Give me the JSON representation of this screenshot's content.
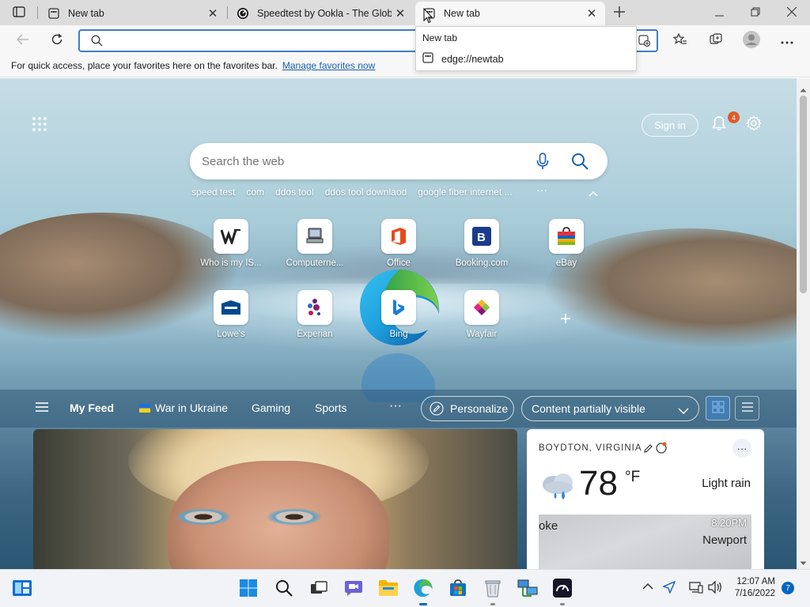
{
  "browser": {
    "tabs": [
      {
        "title": "New tab",
        "active": false
      },
      {
        "title": "Speedtest by Ookla - The Global Broadband Speed Test",
        "active": false
      },
      {
        "title": "New tab",
        "active": true
      }
    ],
    "address": {
      "value": "",
      "placeholder": ""
    },
    "favorites_bar": {
      "text": "For quick access, place your favorites here on the favorites bar.",
      "link": "Manage favorites now"
    },
    "tooltip": {
      "title": "New tab",
      "url": "edge://newtab"
    }
  },
  "newtab": {
    "signin_label": "Sign in",
    "notification_count": "4",
    "search_placeholder": "Search the web",
    "trending": [
      "speed test",
      "com",
      "ddos tool",
      "ddos tool downlaod",
      "google fiber internet ..."
    ],
    "trending_more": "···",
    "quick_links": [
      {
        "label": "Who is my IS..."
      },
      {
        "label": "Computerne..."
      },
      {
        "label": "Office"
      },
      {
        "label": "Booking.com"
      },
      {
        "label": "eBay"
      },
      {
        "label": "Lowe's"
      },
      {
        "label": "Experian"
      },
      {
        "label": "Bing"
      },
      {
        "label": "Wayfair"
      }
    ],
    "feed": {
      "items": [
        "My Feed",
        "War in Ukraine",
        "Gaming",
        "Sports"
      ],
      "more": "···",
      "personalize": "Personalize",
      "content_visibility": "Content partially visible"
    },
    "weather": {
      "location": "BOYDTON, VIRGINIA",
      "more": "···",
      "temp": "78",
      "unit": "°F",
      "condition": "Light rain",
      "map_left_label": "oke",
      "map_right_label": "Newport",
      "map_time": "8:20PM"
    }
  },
  "taskbar": {
    "time": "12:07 AM",
    "date": "7/16/2022",
    "notification_count": "7"
  },
  "colors": {
    "accent": "#0067c0",
    "badge": "#e05a2a",
    "address_border": "#3f7fbf"
  }
}
